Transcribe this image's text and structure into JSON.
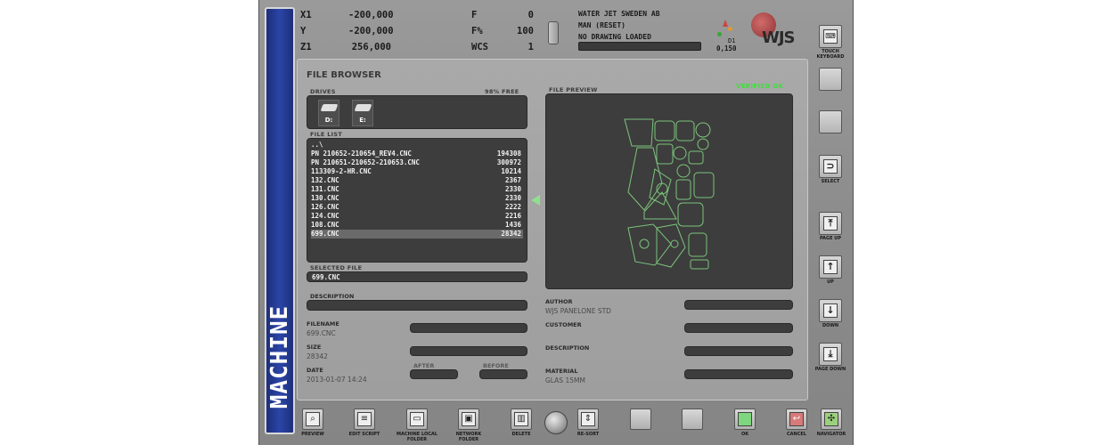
{
  "status": {
    "axes": [
      {
        "label": "X1",
        "value": "-200,000"
      },
      {
        "label": "Y",
        "value": "-200,000"
      },
      {
        "label": "Z1",
        "value": "256,000"
      }
    ],
    "params": [
      {
        "label": "F",
        "value": "0"
      },
      {
        "label": "F%",
        "value": "100"
      },
      {
        "label": "WCS",
        "value": "1"
      }
    ],
    "company": "WATER JET SWEDEN AB",
    "mode": "MAN (RESET)",
    "drawing": "NO DRAWING LOADED",
    "head": "D1",
    "head_value": "0,150",
    "logo": "WJS"
  },
  "sidebar": {
    "label": "MACHINE"
  },
  "file_browser": {
    "title": "FILE BROWSER",
    "drives_label": "DRIVES",
    "free": "98% FREE",
    "drives": [
      {
        "label": "D:"
      },
      {
        "label": "E:"
      }
    ],
    "file_list_label": "FILE LIST",
    "files": [
      {
        "name": "..\\",
        "size": ""
      },
      {
        "name": "PN 210652-210654_REV4.CNC",
        "size": "194308"
      },
      {
        "name": "PN 210651-210652-210653.CNC",
        "size": "300972"
      },
      {
        "name": "113309-2-HR.CNC",
        "size": "10214"
      },
      {
        "name": "132.CNC",
        "size": "2367"
      },
      {
        "name": "131.CNC",
        "size": "2330"
      },
      {
        "name": "130.CNC",
        "size": "2330"
      },
      {
        "name": "126.CNC",
        "size": "2222"
      },
      {
        "name": "124.CNC",
        "size": "2216"
      },
      {
        "name": "108.CNC",
        "size": "1436"
      },
      {
        "name": "699.CNC",
        "size": "28342"
      }
    ],
    "selected_label": "SELECTED FILE",
    "selected": "699.CNC",
    "description_label": "DESCRIPTION",
    "filename_label": "FILENAME",
    "filename": "699.CNC",
    "size_label": "SIZE",
    "size": "28342",
    "date_label": "DATE",
    "date": "2013-01-07 14:24",
    "after_label": "AFTER",
    "before_label": "BEFORE",
    "preview_label": "FILE PREVIEW",
    "verified": "VERIFIED OK",
    "author_label": "AUTHOR",
    "author": "WJS PANELONE STD",
    "customer_label": "CUSTOMER",
    "description2_label": "DESCRIPTION",
    "material_label": "MATERIAL",
    "material": "GLAS 15MM"
  },
  "right_buttons": [
    {
      "label": "TOUCH KEYBOARD",
      "icon": "keyboard-icon"
    },
    {
      "label": "",
      "icon": "blank-icon"
    },
    {
      "label": "",
      "icon": "blank-icon"
    },
    {
      "label": "SELECT",
      "icon": "select-icon"
    },
    {
      "label": "PAGE UP",
      "icon": "page-up-icon"
    },
    {
      "label": "UP",
      "icon": "up-arrow-icon"
    },
    {
      "label": "DOWN",
      "icon": "down-arrow-icon"
    },
    {
      "label": "PAGE DOWN",
      "icon": "page-down-icon"
    }
  ],
  "bottom_buttons": [
    {
      "label": "PREVIEW"
    },
    {
      "label": "EDIT SCRIPT"
    },
    {
      "label": "MACHINE LOCAL FOLDER"
    },
    {
      "label": "NETWORK FOLDER"
    },
    {
      "label": "DELETE"
    },
    {
      "label": "RE-SORT"
    },
    {
      "label": ""
    },
    {
      "label": ""
    },
    {
      "label": "OK"
    },
    {
      "label": "CANCEL"
    },
    {
      "label": "NAVIGATOR"
    }
  ],
  "colors": {
    "sidebar": "#2b45a8",
    "verified": "#3ce03c",
    "preview_lines": "#7cc47c"
  }
}
